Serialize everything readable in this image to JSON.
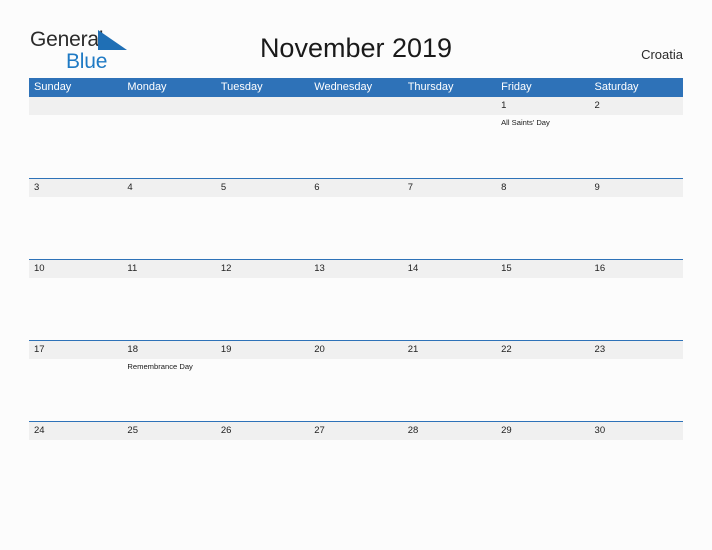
{
  "brand": {
    "name_part1": "General",
    "name_part2": "Blue",
    "flag_icon": "triangle-flag-icon",
    "color_dark": "#2b2b2b",
    "color_blue": "#1f7ac4"
  },
  "header": {
    "title": "November 2019",
    "region": "Croatia"
  },
  "theme": {
    "header_blue": "#2e72b8",
    "band_gray": "#f0f0f0",
    "page_background": "#fcfcfc",
    "accent_blue": "#1f7ac4"
  },
  "calendar": {
    "month": "November",
    "year": "2019",
    "weekdays": [
      "Sunday",
      "Monday",
      "Tuesday",
      "Wednesday",
      "Thursday",
      "Friday",
      "Saturday"
    ],
    "weeks": [
      {
        "days": [
          {
            "date": "",
            "events": []
          },
          {
            "date": "",
            "events": []
          },
          {
            "date": "",
            "events": []
          },
          {
            "date": "",
            "events": []
          },
          {
            "date": "",
            "events": []
          },
          {
            "date": "1",
            "events": [
              "All Saints' Day"
            ]
          },
          {
            "date": "2",
            "events": []
          }
        ]
      },
      {
        "days": [
          {
            "date": "3",
            "events": []
          },
          {
            "date": "4",
            "events": []
          },
          {
            "date": "5",
            "events": []
          },
          {
            "date": "6",
            "events": []
          },
          {
            "date": "7",
            "events": []
          },
          {
            "date": "8",
            "events": []
          },
          {
            "date": "9",
            "events": []
          }
        ]
      },
      {
        "days": [
          {
            "date": "10",
            "events": []
          },
          {
            "date": "11",
            "events": []
          },
          {
            "date": "12",
            "events": []
          },
          {
            "date": "13",
            "events": []
          },
          {
            "date": "14",
            "events": []
          },
          {
            "date": "15",
            "events": []
          },
          {
            "date": "16",
            "events": []
          }
        ]
      },
      {
        "days": [
          {
            "date": "17",
            "events": []
          },
          {
            "date": "18",
            "events": [
              "Remembrance Day"
            ]
          },
          {
            "date": "19",
            "events": []
          },
          {
            "date": "20",
            "events": []
          },
          {
            "date": "21",
            "events": []
          },
          {
            "date": "22",
            "events": []
          },
          {
            "date": "23",
            "events": []
          }
        ]
      },
      {
        "days": [
          {
            "date": "24",
            "events": []
          },
          {
            "date": "25",
            "events": []
          },
          {
            "date": "26",
            "events": []
          },
          {
            "date": "27",
            "events": []
          },
          {
            "date": "28",
            "events": []
          },
          {
            "date": "29",
            "events": []
          },
          {
            "date": "30",
            "events": []
          }
        ]
      }
    ]
  }
}
